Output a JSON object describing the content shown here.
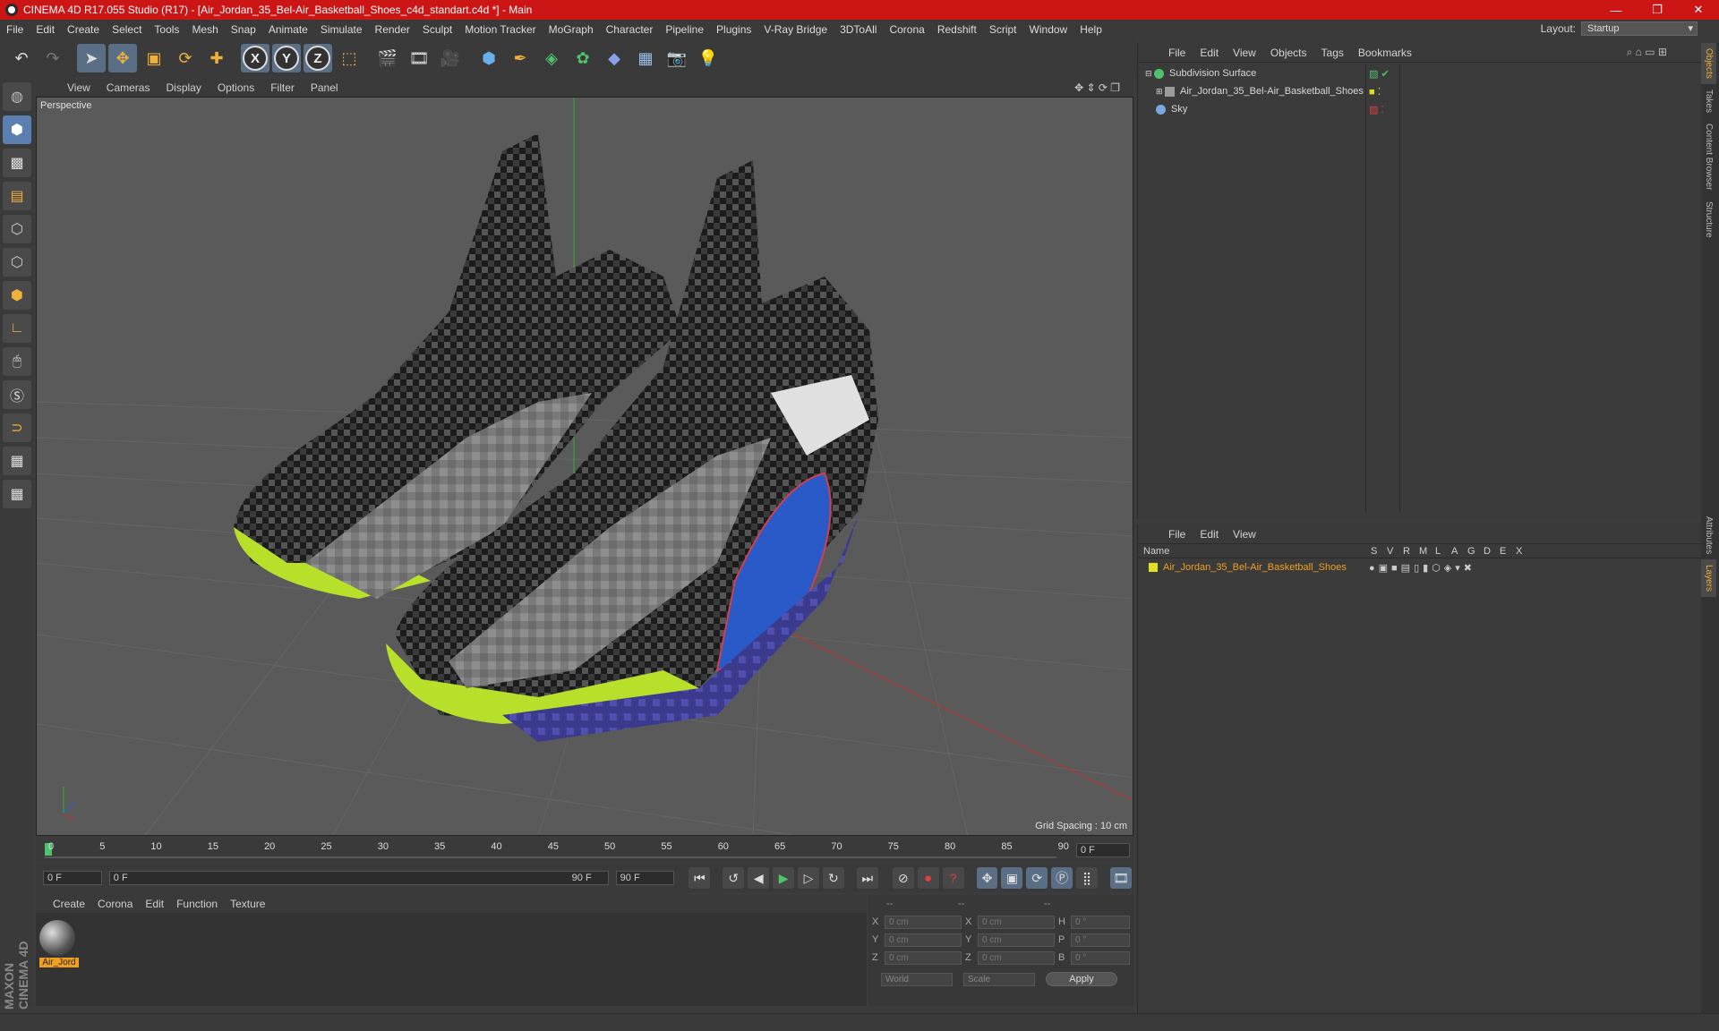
{
  "title": "CINEMA 4D R17.055 Studio (R17) - [Air_Jordan_35_Bel-Air_Basketball_Shoes_c4d_standart.c4d *] - Main",
  "menus": [
    "File",
    "Edit",
    "Create",
    "Select",
    "Tools",
    "Mesh",
    "Snap",
    "Animate",
    "Simulate",
    "Render",
    "Sculpt",
    "Motion Tracker",
    "MoGraph",
    "Character",
    "Pipeline",
    "Plugins",
    "V-Ray Bridge",
    "3DToAll",
    "Corona",
    "Redshift",
    "Script",
    "Window",
    "Help"
  ],
  "layout": {
    "label": "Layout:",
    "value": "Startup"
  },
  "viewport": {
    "menus": [
      "View",
      "Cameras",
      "Display",
      "Options",
      "Filter",
      "Panel"
    ],
    "camera": "Perspective",
    "grid": "Grid Spacing : 10 cm"
  },
  "timeline": {
    "ticks": [
      "0",
      "5",
      "10",
      "15",
      "20",
      "25",
      "30",
      "35",
      "40",
      "45",
      "50",
      "55",
      "60",
      "65",
      "70",
      "75",
      "80",
      "85",
      "90"
    ],
    "frame_field": "0 F"
  },
  "playback": {
    "start": "0 F",
    "range_start": "0 F",
    "range_end": "90 F",
    "end": "90 F"
  },
  "materials": {
    "menus": [
      "Create",
      "Corona",
      "Edit",
      "Function",
      "Texture"
    ],
    "item": "Air_Jord"
  },
  "coords": {
    "headers": [
      "--",
      "--",
      "--"
    ],
    "rows": [
      [
        "X",
        "0 cm",
        "X",
        "0 cm",
        "H",
        "0 °"
      ],
      [
        "Y",
        "0 cm",
        "Y",
        "0 cm",
        "P",
        "0 °"
      ],
      [
        "Z",
        "0 cm",
        "Z",
        "0 cm",
        "B",
        "0 °"
      ]
    ],
    "world": "World",
    "scale": "Scale",
    "apply": "Apply"
  },
  "objects": {
    "menus": [
      "File",
      "Edit",
      "View",
      "Objects",
      "Tags",
      "Bookmarks"
    ],
    "items": [
      {
        "name": "Subdivision Surface",
        "color": "#4fc36b"
      },
      {
        "name": "Air_Jordan_35_Bel-Air_Basketball_Shoes",
        "color": "#9a9a9a"
      },
      {
        "name": "Sky",
        "color": "#7aa7e0"
      }
    ]
  },
  "layers": {
    "menus": [
      "File",
      "Edit",
      "View"
    ],
    "cols": [
      "Name",
      "S",
      "V",
      "R",
      "M",
      "L",
      "A",
      "G",
      "D",
      "E",
      "X"
    ],
    "item": "Air_Jordan_35_Bel-Air_Basketball_Shoes"
  },
  "side_tabs": [
    "Objects",
    "Takes",
    "Content Browser",
    "Structure"
  ],
  "side_tabs2": [
    "Attributes",
    "Layers"
  ],
  "logo": "MAXON CINEMA 4D"
}
